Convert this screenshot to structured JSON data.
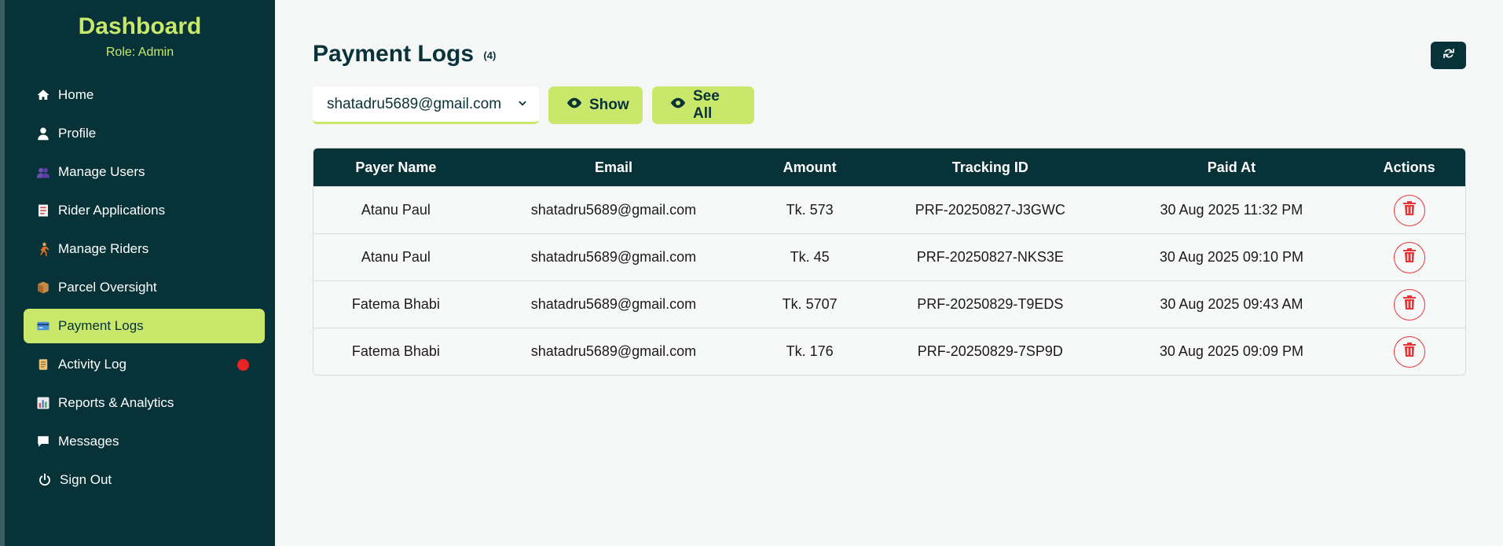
{
  "sidebar": {
    "title": "Dashboard",
    "role": "Role: Admin",
    "items": [
      {
        "label": "Home",
        "icon": "home-icon"
      },
      {
        "label": "Profile",
        "icon": "user-icon"
      },
      {
        "label": "Manage Users",
        "icon": "users-emoji-icon"
      },
      {
        "label": "Rider Applications",
        "icon": "document-emoji-icon"
      },
      {
        "label": "Manage Riders",
        "icon": "runner-emoji-icon"
      },
      {
        "label": "Parcel Oversight",
        "icon": "package-emoji-icon"
      },
      {
        "label": "Payment Logs",
        "icon": "card-emoji-icon"
      },
      {
        "label": "Activity Log",
        "icon": "scroll-emoji-icon"
      },
      {
        "label": "Reports & Analytics",
        "icon": "bar-chart-emoji-icon"
      },
      {
        "label": "Messages",
        "icon": "comment-icon"
      },
      {
        "label": "Sign Out",
        "icon": "power-icon"
      }
    ]
  },
  "header": {
    "title": "Payment Logs",
    "count": "(4)"
  },
  "filter": {
    "selected_email": "shatadru5689@gmail.com",
    "show_label": "Show",
    "see_all_label": "See All"
  },
  "table": {
    "columns": [
      "Payer Name",
      "Email",
      "Amount",
      "Tracking ID",
      "Paid At",
      "Actions"
    ],
    "rows": [
      {
        "name": "Atanu Paul",
        "email": "shatadru5689@gmail.com",
        "amount": "Tk. 573",
        "tracking": "PRF-20250827-J3GWC",
        "paid_at": "30 Aug 2025 11:32 PM"
      },
      {
        "name": "Atanu Paul",
        "email": "shatadru5689@gmail.com",
        "amount": "Tk. 45",
        "tracking": "PRF-20250827-NKS3E",
        "paid_at": "30 Aug 2025 09:10 PM"
      },
      {
        "name": "Fatema Bhabi",
        "email": "shatadru5689@gmail.com",
        "amount": "Tk. 5707",
        "tracking": "PRF-20250829-T9EDS",
        "paid_at": "30 Aug 2025 09:43 AM"
      },
      {
        "name": "Fatema Bhabi",
        "email": "shatadru5689@gmail.com",
        "amount": "Tk. 176",
        "tracking": "PRF-20250829-7SP9D",
        "paid_at": "30 Aug 2025 09:09 PM"
      }
    ]
  },
  "colors": {
    "sidebar_bg": "#063238",
    "accent": "#c9e86b",
    "danger": "#e53535",
    "notification_dot": "#e82424"
  }
}
